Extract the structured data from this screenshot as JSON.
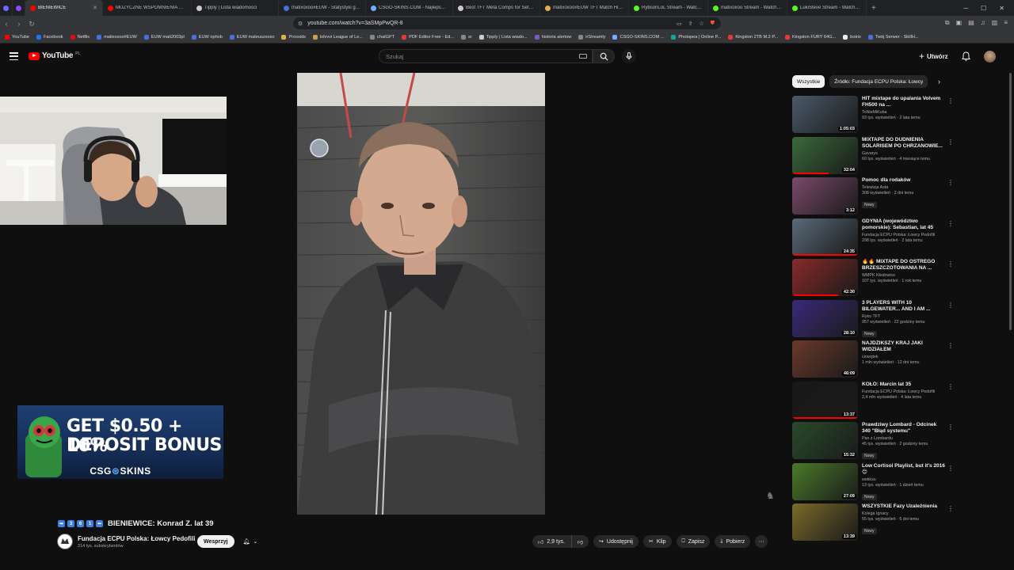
{
  "browser": {
    "tabs": [
      {
        "label": "",
        "color": "#6b6bff"
      },
      {
        "label": "",
        "color": "#9146ff"
      },
      {
        "label": "BIENIEWICE",
        "color": "#ff0000",
        "active": true
      },
      {
        "label": "MUZYCZNE WSPOMNIENIA KL...",
        "color": "#ff0000"
      },
      {
        "label": "Tipply | Lista wiadomości",
        "color": "#cccccc"
      },
      {
        "label": "matixoxoo#EUW - Statystyki gra...",
        "color": "#4a6fe0"
      },
      {
        "label": "CSGO-SKINS.COM - Najlepsze Si...",
        "color": "#6fb0ff"
      },
      {
        "label": "Best TFT Meta Comps for Set 14",
        "color": "#cccccc"
      },
      {
        "label": "matixoxoo#EUW TFT Match Hist...",
        "color": "#e0b04a"
      },
      {
        "label": "RybsonLoL Stream - Watch Live...",
        "color": "#53fc18"
      },
      {
        "label": "matixoxoo Stream - Watch Live ...",
        "color": "#53fc18"
      },
      {
        "label": "LukiSteve Stream - Watch Live o...",
        "color": "#53fc18"
      }
    ],
    "new_tab": "+",
    "url": "youtube.com/watch?v=3aSMpPwQR-8",
    "bookmarks": [
      {
        "label": "YouTube",
        "color": "#ff0000"
      },
      {
        "label": "Facebook",
        "color": "#1877f2"
      },
      {
        "label": "Netflix",
        "color": "#e50914"
      },
      {
        "label": "matixoxoo#EUW",
        "color": "#4a6fe0"
      },
      {
        "label": "EUW mati2003pl",
        "color": "#4a6fe0"
      },
      {
        "label": "EUW ophob",
        "color": "#4a6fe0"
      },
      {
        "label": "EUW mateuszxoxo",
        "color": "#4a6fe0"
      },
      {
        "label": "Proxxids",
        "color": "#e0b04a"
      },
      {
        "label": "lolvvvi League of Le...",
        "color": "#c8a14a"
      },
      {
        "label": "chatGPT",
        "color": "#888888"
      },
      {
        "label": "PDF Editor Free - Ed...",
        "color": "#e53935"
      },
      {
        "label": "sr",
        "color": "#888888"
      },
      {
        "label": "Tipply | Lista wiado...",
        "color": "#cccccc"
      },
      {
        "label": "historia alertow",
        "color": "#7e57c2"
      },
      {
        "label": "irStreamly",
        "color": "#888888"
      },
      {
        "label": "CSGO-SKINS.COM ...",
        "color": "#6fb0ff"
      },
      {
        "label": "Photopea | Online P...",
        "color": "#18a497"
      },
      {
        "label": "Kingston 2TB M.2 P...",
        "color": "#e53935"
      },
      {
        "label": "Kingston FURY 64G...",
        "color": "#e53935"
      },
      {
        "label": "botrix",
        "color": "#eeeeee"
      },
      {
        "label": "Twój Serwer - SkillH...",
        "color": "#4a6fe0"
      }
    ]
  },
  "youtube": {
    "logo_text": "YouTube",
    "country": "PL",
    "search_placeholder": "Szukaj",
    "create_label": "Utwórz"
  },
  "ad": {
    "line1": "GET $0.50 + 10%",
    "line2": "DEPOSIT BONUS",
    "brand_left": "CSG",
    "brand_right": "SKINS"
  },
  "video": {
    "title_emojis": [
      "➡",
      "3",
      "6",
      "1",
      "⬅"
    ],
    "title": "BIENIEWICE: Konrad Z. lat 39",
    "channel_name": "Fundacja ECPU Polska: Łowcy Pedofili",
    "subscribers": "214 tys. subskrybentów",
    "support_label": "Wesprzyj",
    "likes": "2,9 tys.",
    "share_label": "Udostępnij",
    "clip_label": "Klip",
    "save_label": "Zapisz",
    "download_label": "Pobierz"
  },
  "chips": [
    {
      "label": "Wszystkie",
      "active": true
    },
    {
      "label": "Źródło: Fundacja ECPU Polska: Łowcy",
      "active": false
    }
  ],
  "related": [
    {
      "title": "HIT mixtape do upalania Volvem FH500 na ...",
      "channel": "ToNieMiKuba",
      "meta": "93 tys. wyświetleń · 2 lata temu",
      "duration": "1:05:03",
      "new": false,
      "progress": 0.0,
      "thumb": "#4a5a6a"
    },
    {
      "title": "MIXTAPE DO DUDNIENIA SOLARISEM PO CHRZANOWIE...",
      "channel": "Gavarys",
      "meta": "60 tys. wyświetleń · 4 miesiące temu",
      "duration": "32:04",
      "new": false,
      "progress": 0.55,
      "thumb": "#3a6a3a"
    },
    {
      "title": "Pomoc dla rodaków",
      "channel": "Telewizja Asta",
      "meta": "308 wyświetleń · 2 dni temu",
      "duration": "3:12",
      "new": true,
      "progress": 0.0,
      "thumb": "#7a4a6a"
    },
    {
      "title": "GDYNIA (województwo pomorskie): Sebastian, lat 45",
      "channel": "Fundacja ECPU Polska: Łowcy Pedofili",
      "meta": "298 tys. wyświetleń · 2 lata temu",
      "duration": "24:35",
      "new": false,
      "progress": 1.0,
      "thumb": "#5a6a7a"
    },
    {
      "title": "🔥🔥 MIXTAPE DO OSTREGO BRZESZCZOTOWANIA NA ...",
      "channel": "WMPK Kłodowice",
      "meta": "107 tys. wyświetleń · 1 rok temu",
      "duration": "42:30",
      "new": false,
      "progress": 0.7,
      "thumb": "#8a2a2a"
    },
    {
      "title": "3 PLAYERS WITH 10 BILGEWATER... AND I AM ...",
      "channel": "Ryko TFT",
      "meta": "957 wyświetleń · 22 godziny temu",
      "duration": "28:10",
      "new": true,
      "progress": 0.0,
      "thumb": "#3a2a7a"
    },
    {
      "title": "NAJDZIKSZY KRAJ JAKI WIDZIAŁEM",
      "channel": "cewojtek",
      "meta": "1 mln wyświetleń · 12 dni temu",
      "duration": "46:09",
      "new": false,
      "progress": 0.0,
      "thumb": "#6a3a2a"
    },
    {
      "title": "KOŁO: Marcin lat 35",
      "channel": "Fundacja ECPU Polska: Łowcy Pedofili",
      "meta": "2,4 mln wyświetleń · 4 lata temu",
      "duration": "13:37",
      "new": false,
      "progress": 1.0,
      "thumb": "#181818"
    },
    {
      "title": "Prawdziwy Lombard - Odcinek 340 \"Błąd systemu\"",
      "channel": "Pan z Lombardu",
      "meta": "45 tys. wyświetleń · 2 godziny temu",
      "duration": "15:32",
      "new": true,
      "progress": 0.0,
      "thumb": "#2a4a2a"
    },
    {
      "title": "Low Cortisol Playlist, but it's 2016 😊",
      "channel": "wekksu",
      "meta": "13 tys. wyświetleń · 1 dzień temu",
      "duration": "27:09",
      "new": true,
      "progress": 0.0,
      "thumb": "#4a7a2a"
    },
    {
      "title": "WSZYSTKIE Fazy Uzależnienia",
      "channel": "Kolega Ignacy",
      "meta": "55 tys. wyświetleń · 6 dni temu",
      "duration": "13:39",
      "new": true,
      "progress": 0.0,
      "thumb": "#7a6a2a"
    }
  ]
}
